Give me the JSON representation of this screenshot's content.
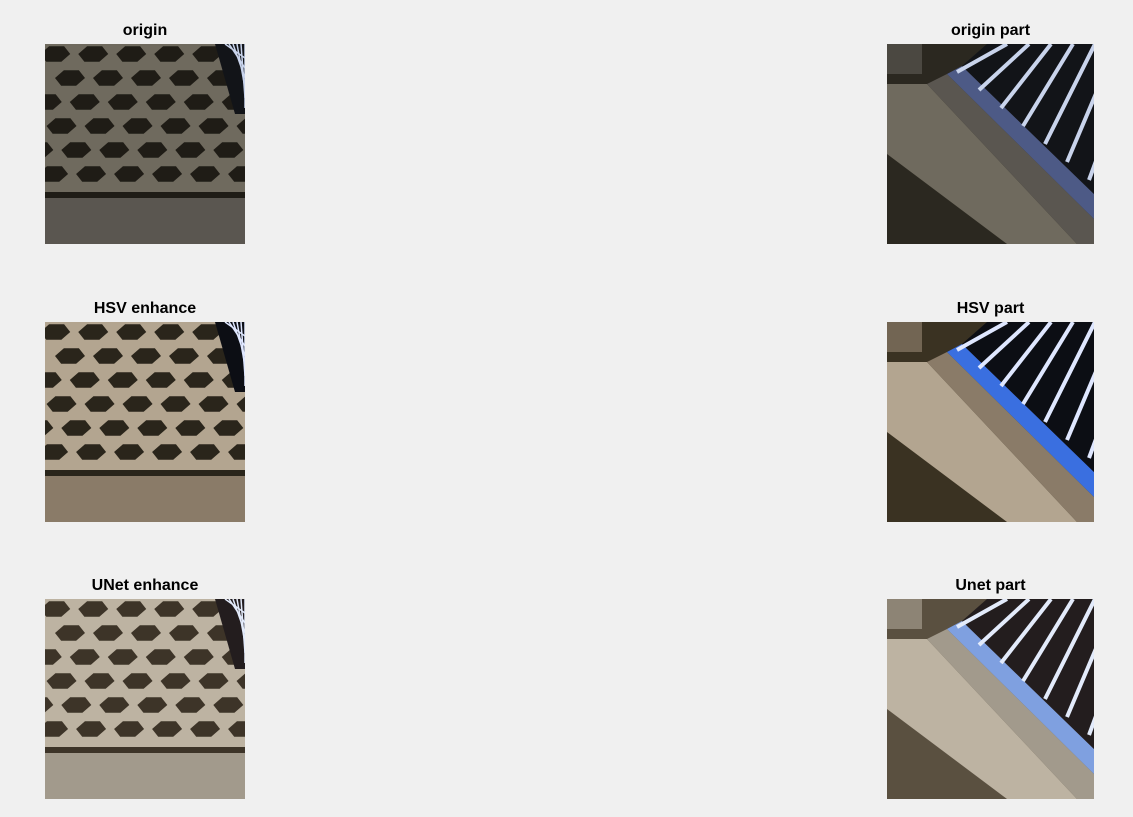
{
  "figure": {
    "background": "#f0f0f0",
    "panels": [
      {
        "id": "origin",
        "title": "origin",
        "variant": "dark",
        "kind": "full"
      },
      {
        "id": "origin_part",
        "title": "origin part",
        "variant": "dark",
        "kind": "part"
      },
      {
        "id": "hsv",
        "title": "HSV enhance",
        "variant": "hsv",
        "kind": "full"
      },
      {
        "id": "hsv_part",
        "title": "HSV part",
        "variant": "hsv",
        "kind": "part"
      },
      {
        "id": "unet",
        "title": "UNet enhance",
        "variant": "unet",
        "kind": "full"
      },
      {
        "id": "unet_part",
        "title": "Unet part",
        "variant": "unet",
        "kind": "part"
      }
    ]
  },
  "palettes": {
    "dark": {
      "ground": "#2b2820",
      "tile": "#6f6a5e",
      "hole": "#1f1c16",
      "slab": "#5a5650",
      "edge": "#4d5a86",
      "bar": "#c9d4ec",
      "gap": "#121418"
    },
    "hsv": {
      "ground": "#3a3222",
      "tile": "#b3a590",
      "hole": "#2a251b",
      "slab": "#8a7b68",
      "edge": "#3a6fe0",
      "bar": "#dfe7ff",
      "gap": "#0c0e14"
    },
    "unet": {
      "ground": "#5a5040",
      "tile": "#bdb3a2",
      "hole": "#3d3428",
      "slab": "#a29a8c",
      "edge": "#7fa0e0",
      "bar": "#e3ebfb",
      "gap": "#231d1e"
    }
  }
}
